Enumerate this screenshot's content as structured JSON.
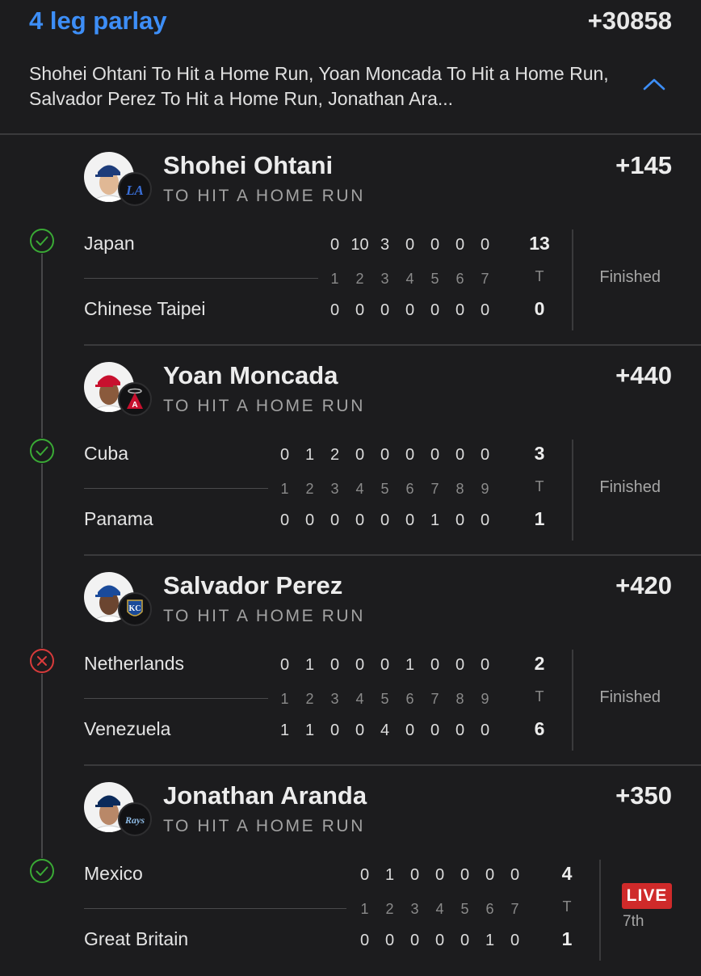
{
  "header": {
    "title": "4 leg parlay",
    "odds": "+30858",
    "summary": "Shohei Ohtani To Hit a Home Run, Yoan Moncada To Hit a Home Run, Salvador Perez To Hit a Home Run, Jonathan Ara..."
  },
  "colors": {
    "accent": "#3d8ef7",
    "win": "#3aaa35",
    "loss": "#d83b3b",
    "live": "#cf2a2a",
    "background": "#1c1c1e"
  },
  "legs": [
    {
      "player": "Shohei Ohtani",
      "market": "TO HIT A HOME RUN",
      "odds": "+145",
      "result_icon": "check-icon",
      "team_icon": "dodgers-logo-icon",
      "home_team": "Japan",
      "away_team": "Chinese Taipei",
      "innings": [
        "1",
        "2",
        "3",
        "4",
        "5",
        "6",
        "7"
      ],
      "home_line": [
        "0",
        "10",
        "3",
        "0",
        "0",
        "0",
        "0"
      ],
      "away_line": [
        "0",
        "0",
        "0",
        "0",
        "0",
        "0",
        "0"
      ],
      "total_label": "T",
      "home_total": "13",
      "away_total": "0",
      "status": "Finished"
    },
    {
      "player": "Yoan Moncada",
      "market": "TO HIT A HOME RUN",
      "odds": "+440",
      "result_icon": "check-icon",
      "team_icon": "angels-logo-icon",
      "home_team": "Cuba",
      "away_team": "Panama",
      "innings": [
        "1",
        "2",
        "3",
        "4",
        "5",
        "6",
        "7",
        "8",
        "9"
      ],
      "home_line": [
        "0",
        "1",
        "2",
        "0",
        "0",
        "0",
        "0",
        "0",
        "0"
      ],
      "away_line": [
        "0",
        "0",
        "0",
        "0",
        "0",
        "0",
        "1",
        "0",
        "0"
      ],
      "total_label": "T",
      "home_total": "3",
      "away_total": "1",
      "status": "Finished"
    },
    {
      "player": "Salvador Perez",
      "market": "TO HIT A HOME RUN",
      "odds": "+420",
      "result_icon": "x-icon",
      "team_icon": "royals-logo-icon",
      "home_team": "Netherlands",
      "away_team": "Venezuela",
      "innings": [
        "1",
        "2",
        "3",
        "4",
        "5",
        "6",
        "7",
        "8",
        "9"
      ],
      "home_line": [
        "0",
        "1",
        "0",
        "0",
        "0",
        "1",
        "0",
        "0",
        "0"
      ],
      "away_line": [
        "1",
        "1",
        "0",
        "0",
        "4",
        "0",
        "0",
        "0",
        "0"
      ],
      "total_label": "T",
      "home_total": "2",
      "away_total": "6",
      "status": "Finished"
    },
    {
      "player": "Jonathan Aranda",
      "market": "TO HIT A HOME RUN",
      "odds": "+350",
      "result_icon": "check-icon",
      "team_icon": "rays-logo-icon",
      "home_team": "Mexico",
      "away_team": "Great Britain",
      "innings": [
        "1",
        "2",
        "3",
        "4",
        "5",
        "6",
        "7"
      ],
      "home_line": [
        "0",
        "1",
        "0",
        "0",
        "0",
        "0",
        "0"
      ],
      "away_line": [
        "0",
        "0",
        "0",
        "0",
        "0",
        "1",
        "0"
      ],
      "total_label": "T",
      "home_total": "4",
      "away_total": "1",
      "live_label": "LIVE",
      "live_inning": "7th"
    }
  ]
}
